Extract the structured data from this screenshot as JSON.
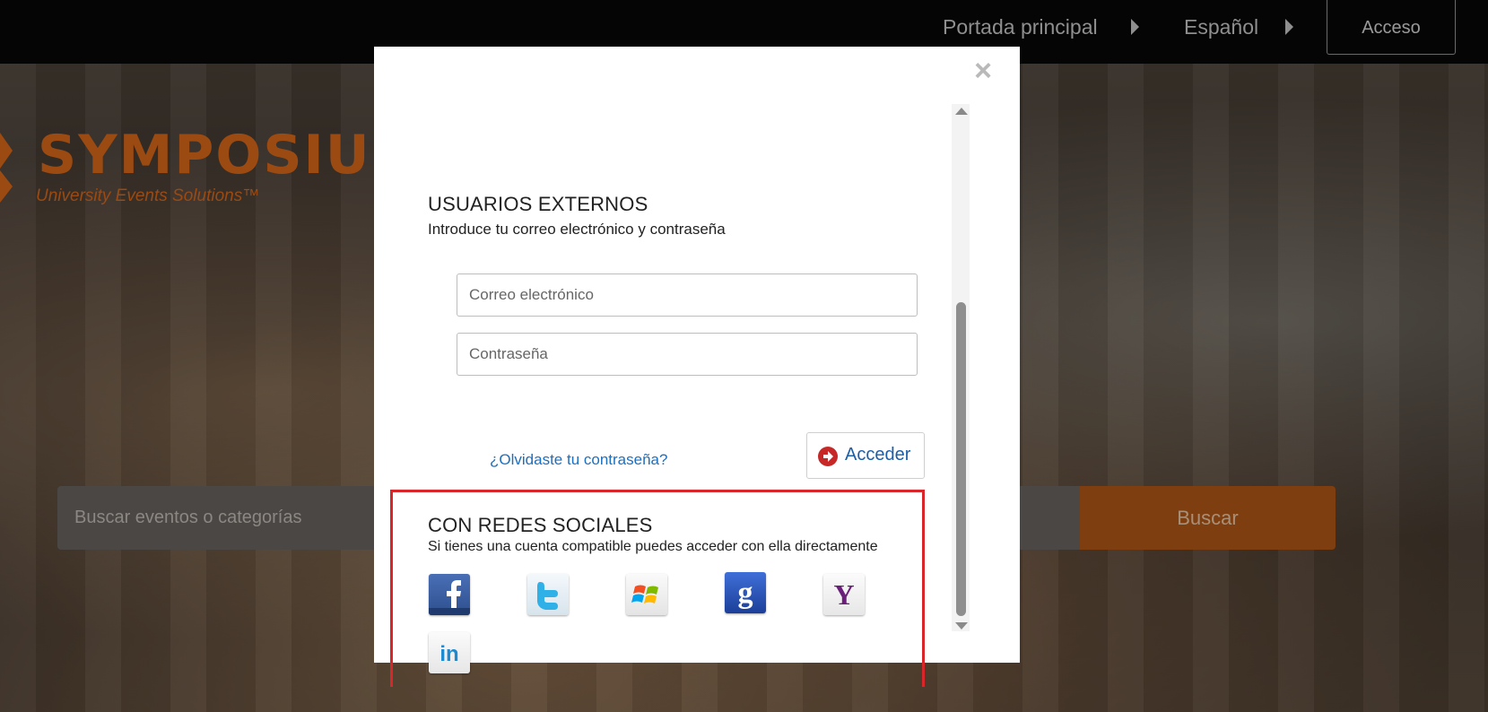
{
  "header": {
    "home_label": "Portada principal",
    "language_label": "Español",
    "login_label": "Acceso"
  },
  "brand": {
    "name": "SYMPOSIUM",
    "tagline": "University Events Solutions™"
  },
  "search": {
    "placeholder": "Buscar eventos o categorías",
    "button_label": "Buscar"
  },
  "modal": {
    "external": {
      "title": "USUARIOS EXTERNOS",
      "subtitle": "Introduce tu correo electrónico y contraseña",
      "email_placeholder": "Correo electrónico",
      "password_placeholder": "Contraseña",
      "forgot_label": "¿Olvidaste tu contraseña?",
      "submit_label": "Acceder"
    },
    "social": {
      "title": "CON REDES SOCIALES",
      "subtitle": "Si tienes una cuenta compatible puedes acceder con ella directamente",
      "providers": [
        "facebook",
        "twitter",
        "windows-live",
        "google",
        "yahoo",
        "linkedin"
      ]
    }
  },
  "colors": {
    "accent_orange": "#9b4a12",
    "link_blue": "#1d6fbf",
    "highlight_red": "#d9262a"
  }
}
